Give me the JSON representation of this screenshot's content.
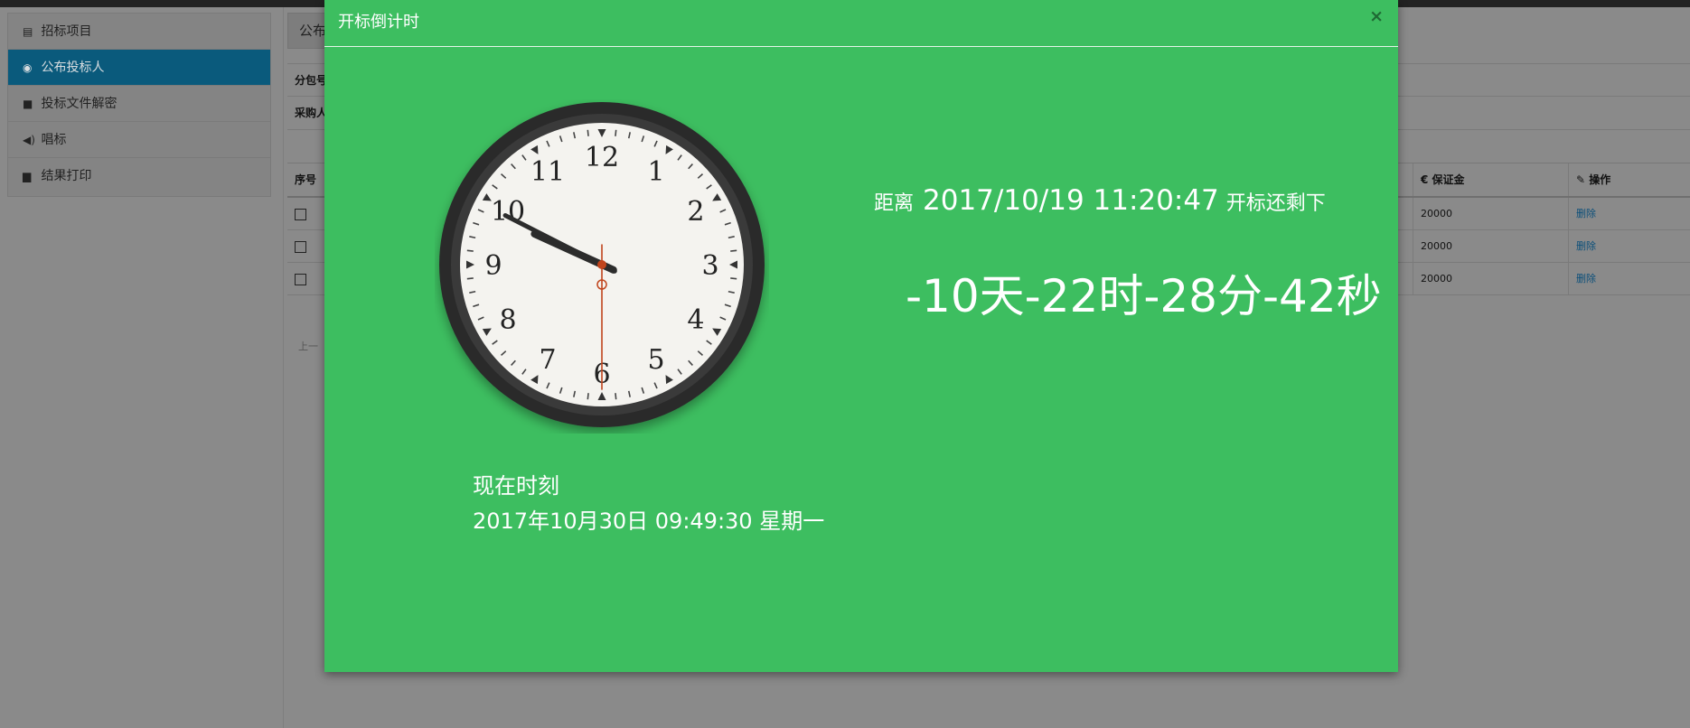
{
  "sidebar": {
    "items": [
      {
        "label": "招标项目",
        "icon": "list-icon",
        "glyph": "▤"
      },
      {
        "label": "公布投标人",
        "icon": "play-circle-icon",
        "glyph": "◉"
      },
      {
        "label": "投标文件解密",
        "icon": "lock-icon",
        "glyph": "■"
      },
      {
        "label": "唱标",
        "icon": "volume-icon",
        "glyph": "◀)"
      },
      {
        "label": "结果打印",
        "icon": "print-icon",
        "glyph": "▆"
      }
    ]
  },
  "main": {
    "tab_label": "公布",
    "info_rows": [
      "分包号",
      "采购人"
    ],
    "table": {
      "headers": {
        "index": "序号",
        "deposit": "€ 保证金",
        "action": "操作"
      },
      "rows": [
        {
          "deposit": "20000",
          "action": "删除"
        },
        {
          "deposit": "20000",
          "action": "删除"
        },
        {
          "deposit": "20000",
          "action": "删除"
        }
      ]
    },
    "pager_text": "上一"
  },
  "modal": {
    "title": "开标倒计时",
    "close": "×",
    "target_prefix": "距离",
    "target_datetime": "2017/10/19 11:20:47",
    "target_suffix": "开标还剩下",
    "countdown": "-10天-22时-28分-42秒",
    "now_label": "现在时刻",
    "now_value": "2017年10月30日 09:49:30 星期一"
  },
  "clock": {
    "hour": 9,
    "minute": 49,
    "second": 30,
    "numerals": [
      "12",
      "1",
      "2",
      "3",
      "4",
      "5",
      "6",
      "7",
      "8",
      "9",
      "10",
      "11"
    ],
    "colors": {
      "bezel": "#2b2b2b",
      "face": "#f4f3ef",
      "hands": "#2c2c2c",
      "second_hand": "#c0441c"
    }
  },
  "colors": {
    "modal_bg": "#3dbe60",
    "active_sidebar": "#0a5a7c"
  }
}
